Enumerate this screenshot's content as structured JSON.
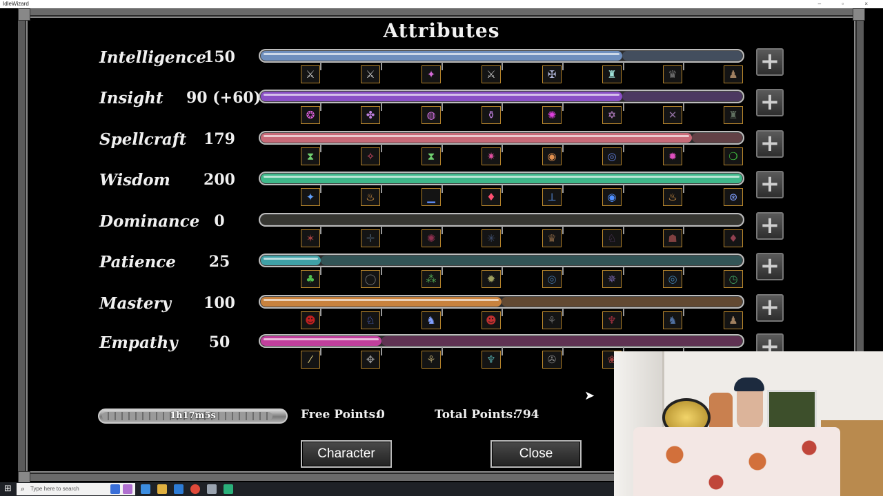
{
  "window": {
    "title": "IdleWizard",
    "controls": "– ▫ ×"
  },
  "screen_title": "Attributes",
  "colors": {
    "intelligence": "#6f8fbe",
    "insight": "#8a4fc6",
    "spellcraft": "#c86a78",
    "wisdom": "#3fb88a",
    "dominance": "#4a4a3c",
    "patience": "#3fa0a6",
    "mastery": "#c8823e",
    "empathy": "#c03f9c"
  },
  "attributes": [
    {
      "name": "Intelligence",
      "value": "150",
      "progress": 0.75,
      "color_key": "intelligence",
      "icons": [
        {
          "glyph": "⚔",
          "color": "#c9c9c9",
          "icon": "sword-icon"
        },
        {
          "glyph": "⚔",
          "color": "#c9c9c9",
          "icon": "swords-icon"
        },
        {
          "glyph": "✦",
          "color": "#d46ad6",
          "icon": "crystal-icon"
        },
        {
          "glyph": "⚔",
          "color": "#c9c9c9",
          "icon": "blade-icon"
        },
        {
          "glyph": "✠",
          "color": "#b0b6d8",
          "icon": "cross-icon"
        },
        {
          "glyph": "♜",
          "color": "#9fe0d8",
          "icon": "tower-icon"
        },
        {
          "glyph": "♛",
          "color": "#777",
          "icon": "crown-icon"
        },
        {
          "glyph": "♟",
          "color": "#a08060",
          "icon": "pawn-icon"
        }
      ]
    },
    {
      "name": "Insight",
      "value": "90 (+60)",
      "progress": 0.75,
      "color_key": "insight",
      "icons": [
        {
          "glyph": "❂",
          "color": "#e060e0",
          "icon": "eye-icon"
        },
        {
          "glyph": "✤",
          "color": "#c080e0",
          "icon": "clover-icon"
        },
        {
          "glyph": "◍",
          "color": "#d070e0",
          "icon": "orb-icon"
        },
        {
          "glyph": "⚱",
          "color": "#c080e0",
          "icon": "urn-icon"
        },
        {
          "glyph": "✺",
          "color": "#e040e0",
          "icon": "burst-icon"
        },
        {
          "glyph": "✡",
          "color": "#d090e0",
          "icon": "star-icon"
        },
        {
          "glyph": "✕",
          "color": "#9070a0",
          "icon": "cross-blades-icon"
        },
        {
          "glyph": "♜",
          "color": "#607060",
          "icon": "fort-icon"
        }
      ]
    },
    {
      "name": "Spellcraft",
      "value": "179",
      "progress": 0.895,
      "color_key": "spellcraft",
      "icons": [
        {
          "glyph": "⧗",
          "color": "#70d070",
          "icon": "hourglass-icon"
        },
        {
          "glyph": "✧",
          "color": "#e05070",
          "icon": "spark-icon"
        },
        {
          "glyph": "⧗",
          "color": "#70d070",
          "icon": "hourglass-green-icon"
        },
        {
          "glyph": "✷",
          "color": "#e050a0",
          "icon": "starburst-icon"
        },
        {
          "glyph": "◉",
          "color": "#e09050",
          "icon": "target-icon"
        },
        {
          "glyph": "◎",
          "color": "#6080e0",
          "icon": "rune-circle-icon"
        },
        {
          "glyph": "✹",
          "color": "#e050c0",
          "icon": "pink-burst-icon"
        },
        {
          "glyph": "❍",
          "color": "#40c040",
          "icon": "ring-icon"
        }
      ]
    },
    {
      "name": "Wisdom",
      "value": "200",
      "progress": 1.0,
      "color_key": "wisdom",
      "icons": [
        {
          "glyph": "✦",
          "color": "#60a0ff",
          "icon": "blue-star-icon"
        },
        {
          "glyph": "♨",
          "color": "#ffb050",
          "icon": "candle-icon"
        },
        {
          "glyph": "▁",
          "color": "#6090ff",
          "icon": "platform-icon"
        },
        {
          "glyph": "♦",
          "color": "#ff5070",
          "icon": "flame-icon"
        },
        {
          "glyph": "⊥",
          "color": "#60a0ff",
          "icon": "pedestal-icon"
        },
        {
          "glyph": "◉",
          "color": "#5090ff",
          "icon": "blue-orb-icon"
        },
        {
          "glyph": "♨",
          "color": "#ffb050",
          "icon": "torch-icon"
        },
        {
          "glyph": "⊛",
          "color": "#80a0ff",
          "icon": "portal-icon"
        }
      ]
    },
    {
      "name": "Dominance",
      "value": "0",
      "progress": 0.0,
      "color_key": "dominance",
      "icons": [
        {
          "glyph": "✶",
          "color": "#a04040",
          "icon": "red-spark-icon"
        },
        {
          "glyph": "✛",
          "color": "#405060",
          "icon": "crosshair-icon"
        },
        {
          "glyph": "✺",
          "color": "#903050",
          "icon": "splat-icon"
        },
        {
          "glyph": "✳",
          "color": "#405070",
          "icon": "asterisk-icon"
        },
        {
          "glyph": "♛",
          "color": "#806040",
          "icon": "crown-flames-icon"
        },
        {
          "glyph": "♘",
          "color": "#604070",
          "icon": "knight-icon"
        },
        {
          "glyph": "☗",
          "color": "#804040",
          "icon": "house-icon"
        },
        {
          "glyph": "♦",
          "color": "#904050",
          "icon": "drop-icon"
        }
      ]
    },
    {
      "name": "Patience",
      "value": "25",
      "progress": 0.125,
      "color_key": "patience",
      "icons": [
        {
          "glyph": "♣",
          "color": "#50c050",
          "icon": "frog-icon"
        },
        {
          "glyph": "◯",
          "color": "#707070",
          "icon": "circle-icon"
        },
        {
          "glyph": "⁂",
          "color": "#50a050",
          "icon": "clusters-icon"
        },
        {
          "glyph": "✹",
          "color": "#a0a060",
          "icon": "sun-icon"
        },
        {
          "glyph": "◎",
          "color": "#4070a0",
          "icon": "spiral-icon"
        },
        {
          "glyph": "✵",
          "color": "#7060a0",
          "icon": "nebula-icon"
        },
        {
          "glyph": "◎",
          "color": "#4080b0",
          "icon": "vortex-icon"
        },
        {
          "glyph": "◷",
          "color": "#40a060",
          "icon": "clock-icon"
        }
      ]
    },
    {
      "name": "Mastery",
      "value": "100",
      "progress": 0.5,
      "color_key": "mastery",
      "icons": [
        {
          "glyph": "☻",
          "color": "#c02020",
          "icon": "demon-icon"
        },
        {
          "glyph": "♘",
          "color": "#6080ff",
          "icon": "blue-knight-icon"
        },
        {
          "glyph": "♞",
          "color": "#80a0ff",
          "icon": "armor-icon"
        },
        {
          "glyph": "☻",
          "color": "#c03030",
          "icon": "red-mask-icon"
        },
        {
          "glyph": "⚘",
          "color": "#606060",
          "icon": "statue-icon"
        },
        {
          "glyph": "♆",
          "color": "#a03040",
          "icon": "trident-icon"
        },
        {
          "glyph": "♞",
          "color": "#5070a0",
          "icon": "beast-icon"
        },
        {
          "glyph": "♟",
          "color": "#a08060",
          "icon": "figure-icon"
        }
      ]
    },
    {
      "name": "Empathy",
      "value": "50",
      "progress": 0.25,
      "color_key": "empathy",
      "icons": [
        {
          "glyph": "⁄",
          "color": "#e0d080",
          "icon": "bone-icon"
        },
        {
          "glyph": "✥",
          "color": "#909090",
          "icon": "flower-icon"
        },
        {
          "glyph": "⚘",
          "color": "#a09060",
          "icon": "plant-icon"
        },
        {
          "glyph": "♆",
          "color": "#50a0a0",
          "icon": "spire-icon"
        },
        {
          "glyph": "✇",
          "color": "#808080",
          "icon": "wheel-icon"
        },
        {
          "glyph": "❀",
          "color": "#a04040",
          "icon": "rose-icon"
        },
        {
          "glyph": "",
          "color": "#000",
          "icon": "hidden-icon"
        },
        {
          "glyph": "",
          "color": "#000",
          "icon": "hidden-icon"
        }
      ]
    }
  ],
  "timer": {
    "text": "1h17m5s",
    "progress": 0.92
  },
  "free_points": {
    "label": "Free Points:",
    "value": "0"
  },
  "total_points": {
    "label": "Total Points:",
    "value": "794"
  },
  "buttons": {
    "character": "Character",
    "close": "Close"
  },
  "taskbar": {
    "search_placeholder": "Type here to search"
  }
}
